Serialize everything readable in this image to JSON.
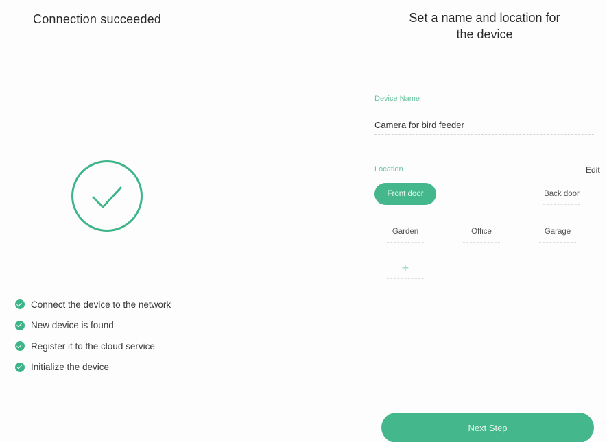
{
  "connection_screen": {
    "title": "Connection succeeded",
    "status_icon": "check-circle-icon",
    "steps": [
      {
        "label": "Connect the device to the  network",
        "icon": "check-badge-icon"
      },
      {
        "label": "New device is found",
        "icon": "check-badge-icon"
      },
      {
        "label": "Register it to the cloud service",
        "icon": "check-badge-icon"
      },
      {
        "label": "Initialize the device",
        "icon": "check-badge-icon"
      }
    ]
  },
  "setup_screen": {
    "title_line1": "Set a name and location for",
    "title_line2": "the device",
    "device_name": {
      "label": "Device Name",
      "value": "Camera for bird feeder"
    },
    "location": {
      "label": "Location",
      "edit_label": "Edit",
      "options": [
        "Front door",
        "Back door",
        "Garden",
        "Office",
        "Garage"
      ],
      "selected": "Front door",
      "add_label": "+"
    },
    "next_button_label": "Next Step"
  },
  "colors": {
    "accent": "#3eb489",
    "chip_selected": "#45b78c",
    "label_green": "#6cc4a0"
  }
}
